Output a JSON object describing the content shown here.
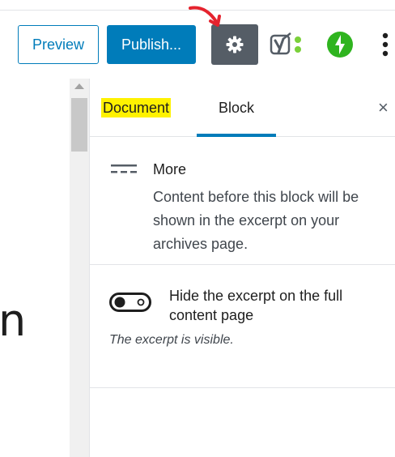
{
  "toolbar": {
    "preview_label": "Preview",
    "publish_label": "Publish...",
    "settings_icon": "gear-icon",
    "yoast_icon": "yoast-icon",
    "jetpack_icon": "jetpack-icon",
    "more_icon": "more-vertical-icon",
    "colors": {
      "accent": "#007cba",
      "settings_bg": "#555d66",
      "jetpack": "#2fb41f",
      "yoast_green": "#7ad03a",
      "annotation_arrow": "#e5232e"
    }
  },
  "editor": {
    "visible_glyph": "n"
  },
  "sidebar": {
    "tabs": [
      {
        "label": "Document",
        "highlighted": true,
        "highlight_color": "#fff200"
      },
      {
        "label": "Block",
        "active": true
      }
    ],
    "close_label": "×",
    "block_card": {
      "icon": "more-block-icon",
      "title": "More",
      "description": "Content before this block will be shown in the excerpt on your archives page."
    },
    "excerpt_setting": {
      "toggle_label": "Hide the excerpt on the full content page",
      "toggle_on": false,
      "help_text": "The excerpt is visible."
    }
  }
}
